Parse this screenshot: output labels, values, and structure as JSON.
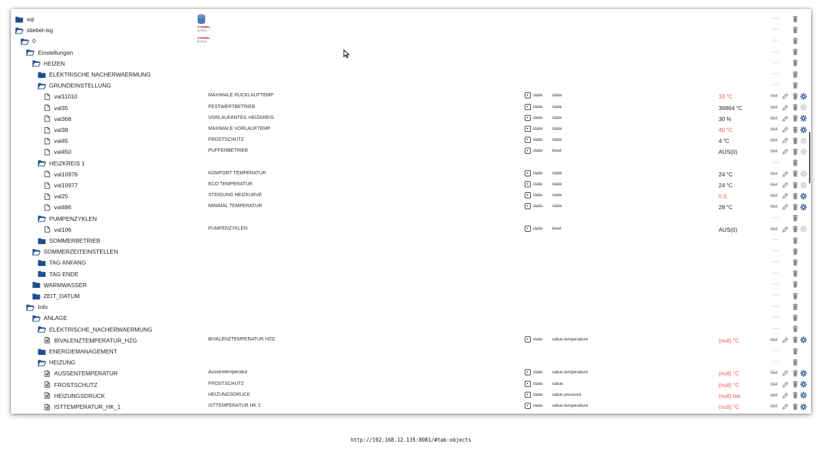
{
  "rows": [
    {
      "kind": "folder",
      "open": false,
      "level": 0,
      "label": "sql",
      "adapter": "sql"
    },
    {
      "kind": "folder",
      "open": true,
      "level": 0,
      "label": "stiebel-isg",
      "adapter": "stiebel"
    },
    {
      "kind": "folder",
      "open": true,
      "level": 1,
      "label": "0",
      "adapter": "stiebel"
    },
    {
      "kind": "folder",
      "open": true,
      "level": 2,
      "label": "Einstellungen"
    },
    {
      "kind": "folder",
      "open": true,
      "level": 3,
      "label": "HEIZEN"
    },
    {
      "kind": "folder",
      "open": false,
      "level": 4,
      "label": "ELEKTRISCHE NACHERWAERMUNG"
    },
    {
      "kind": "folder",
      "open": true,
      "level": 4,
      "label": "GRUNDEINSTELLUNG"
    },
    {
      "kind": "state",
      "level": 5,
      "label": "val11010",
      "name": "MAXIMALE RÜCKLAUFTEMP",
      "type": "state",
      "role": "state",
      "value": "33",
      "unit": "°C",
      "red": true,
      "acl": "664",
      "gear": true
    },
    {
      "kind": "state",
      "level": 5,
      "label": "val35",
      "name": "FESTWERTBETRIEB",
      "type": "state",
      "role": "state",
      "value": "36864",
      "unit": "°C",
      "red": false,
      "acl": "664",
      "gear": false
    },
    {
      "kind": "state",
      "level": 5,
      "label": "val368",
      "name": "VORLAUFANTEIL HEIZKREIS",
      "type": "state",
      "role": "state",
      "value": "30",
      "unit": "%",
      "red": false,
      "acl": "664",
      "gear": true
    },
    {
      "kind": "state",
      "level": 5,
      "label": "val38",
      "name": "MAXIMALE VORLAUFTEMP",
      "type": "state",
      "role": "state",
      "value": "40",
      "unit": "°C",
      "red": true,
      "acl": "664",
      "gear": true
    },
    {
      "kind": "state",
      "level": 5,
      "label": "val45",
      "name": "FROSTSCHUTZ",
      "type": "state",
      "role": "state",
      "value": "4",
      "unit": "°C",
      "red": false,
      "acl": "664",
      "gear": false
    },
    {
      "kind": "state",
      "level": 5,
      "label": "val450",
      "name": "PUFFERBETRIEB",
      "type": "state",
      "role": "level",
      "value": "AUS",
      "unit": "(0)",
      "red": false,
      "acl": "664",
      "gear": false
    },
    {
      "kind": "folder",
      "open": true,
      "level": 4,
      "label": "HEIZKREIS 1"
    },
    {
      "kind": "state",
      "level": 5,
      "label": "val10976",
      "name": "KOMFORT TEMPERATUR",
      "type": "state",
      "role": "state",
      "value": "24",
      "unit": "°C",
      "red": false,
      "acl": "664",
      "gear": false
    },
    {
      "kind": "state",
      "level": 5,
      "label": "val10977",
      "name": "ECO TEMPERATUR",
      "type": "state",
      "role": "state",
      "value": "24",
      "unit": "°C",
      "red": false,
      "acl": "664",
      "gear": false
    },
    {
      "kind": "state",
      "level": 5,
      "label": "val25",
      "name": "STEIGUNG HEIZKURVE",
      "type": "state",
      "role": "state",
      "value": "0,6",
      "unit": "",
      "red": true,
      "acl": "664",
      "gear": true
    },
    {
      "kind": "state",
      "level": 5,
      "label": "val486",
      "name": "MINIMAL TEMPERATUR",
      "type": "state",
      "role": "state",
      "value": "28",
      "unit": "°C",
      "red": false,
      "acl": "664",
      "gear": true
    },
    {
      "kind": "folder",
      "open": true,
      "level": 4,
      "label": "PUMPENZYKLEN"
    },
    {
      "kind": "state",
      "level": 5,
      "label": "val106",
      "name": "PUMPENZYKLEN",
      "type": "state",
      "role": "level",
      "value": "AUS",
      "unit": "(0)",
      "red": false,
      "acl": "664",
      "gear": false
    },
    {
      "kind": "folder",
      "open": false,
      "level": 4,
      "label": "SOMMERBETRIEB"
    },
    {
      "kind": "folder",
      "open": true,
      "level": 3,
      "label": "SOMMERZEITEINSTELLEN"
    },
    {
      "kind": "folder",
      "open": false,
      "level": 4,
      "label": "TAG ANFANG"
    },
    {
      "kind": "folder",
      "open": false,
      "level": 4,
      "label": "TAG ENDE"
    },
    {
      "kind": "folder",
      "open": false,
      "level": 3,
      "label": "WARMWASSER"
    },
    {
      "kind": "folder",
      "open": false,
      "level": 3,
      "label": "ZEIT_DATUM"
    },
    {
      "kind": "folder",
      "open": true,
      "level": 2,
      "label": "Info"
    },
    {
      "kind": "folder",
      "open": true,
      "level": 3,
      "label": "ANLAGE"
    },
    {
      "kind": "folder",
      "open": true,
      "level": 4,
      "label": "ELEKTRISCHE_NACHERWAERMUNG"
    },
    {
      "kind": "state",
      "level": 5,
      "label": "BIVALENZTEMPERATUR_HZG",
      "name": "BIVALENZTEMPERATUR HZG",
      "type": "state",
      "role": "value.temperature",
      "value": "(null)",
      "unit": "°C",
      "red": true,
      "acl": "664",
      "gear": true,
      "ro": true
    },
    {
      "kind": "folder",
      "open": false,
      "level": 4,
      "label": "ENERGIEMANAGEMENT"
    },
    {
      "kind": "folder",
      "open": true,
      "level": 4,
      "label": "HEIZUNG"
    },
    {
      "kind": "state",
      "level": 5,
      "label": "AUSSENTEMPERATUR",
      "name": "Aussentemperatur",
      "type": "state",
      "role": "value.temperature",
      "value": "(null)",
      "unit": "°C",
      "red": true,
      "acl": "664",
      "gear": true,
      "ro": true
    },
    {
      "kind": "state",
      "level": 5,
      "label": "FROSTSCHUTZ",
      "name": "FROSTSCHUTZ",
      "type": "state",
      "role": "value",
      "value": "(null)",
      "unit": "°C",
      "red": true,
      "acl": "664",
      "gear": true,
      "ro": true
    },
    {
      "kind": "state",
      "level": 5,
      "label": "HEIZUNGSDRUCK",
      "name": "HEIZUNGSDRUCK",
      "type": "state",
      "role": "value.pressure",
      "value": "(null)",
      "unit": "bar",
      "red": true,
      "acl": "664",
      "gear": true,
      "ro": true
    },
    {
      "kind": "state",
      "level": 5,
      "label": "ISTTEMPERATUR_HK_1",
      "name": "ISTTEMPERATUR HK 1",
      "type": "state",
      "role": "value.temperature",
      "value": "(null)",
      "unit": "°C",
      "red": true,
      "acl": "664",
      "gear": true,
      "ro": true
    }
  ],
  "adapters": {
    "stiebel": {
      "line1": "STIEBEL",
      "line2": "ELTRON"
    }
  },
  "dash": "—",
  "url": "http://192.168.12.135:8081/#tab-objects",
  "colors": {
    "folder": "#1f4e8c",
    "red": "#f0564c",
    "icon": "#444",
    "gear": "#4a6fa0",
    "gearDisabled": "#cccccc",
    "trash": "#8a8a8a"
  }
}
